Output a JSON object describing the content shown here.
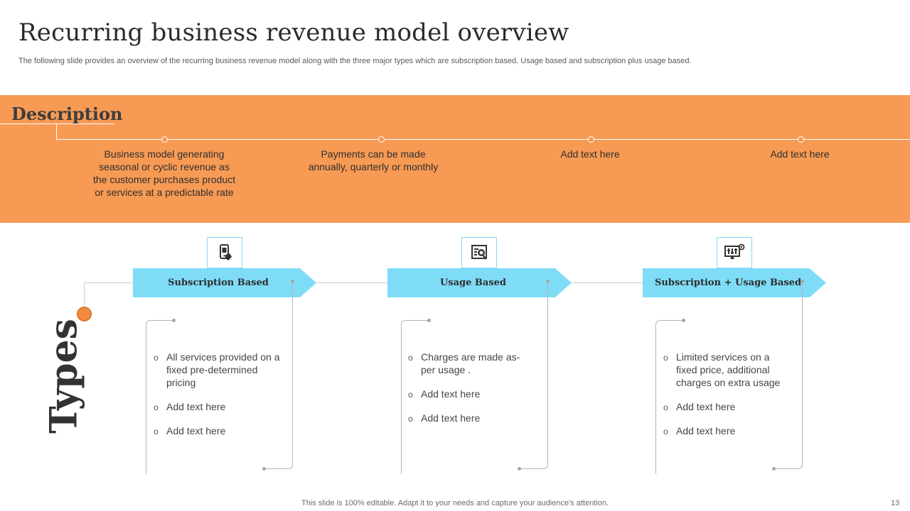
{
  "slide": {
    "title": "Recurring business revenue model overview",
    "subtitle": "The following slide provides an overview of the recurring business revenue model along with the three major types which are subscription based, Usage based and subscription plus usage based.",
    "footer": "This slide is 100% editable. Adapt it to your needs and capture your audience's attention.",
    "page_number": "13"
  },
  "colors": {
    "band": "#f79a54",
    "arrow": "#7fdcf7",
    "types_dot": "#f28b3c"
  },
  "description": {
    "heading": "Description",
    "items": [
      "Business model generating seasonal or cyclic revenue as the customer purchases product or services at a predictable rate",
      "Payments can be made annually, quarterly or monthly",
      "Add text here",
      "Add text here"
    ]
  },
  "types": {
    "heading": "Types",
    "items": [
      {
        "label": "Subscription Based",
        "icon": "mobile-payment-icon",
        "bullets": [
          "All services provided on a fixed pre-determined pricing",
          "Add text here",
          "Add text here"
        ]
      },
      {
        "label": "Usage Based",
        "icon": "usage-analytics-icon",
        "bullets": [
          "Charges are made as-per usage .",
          "Add text here",
          "Add text here"
        ]
      },
      {
        "label": "Subscription + Usage Based",
        "icon": "monitor-settings-icon",
        "bullets": [
          "Limited services on a fixed price, additional charges on extra usage",
          "Add text here",
          "Add text here"
        ]
      }
    ]
  }
}
